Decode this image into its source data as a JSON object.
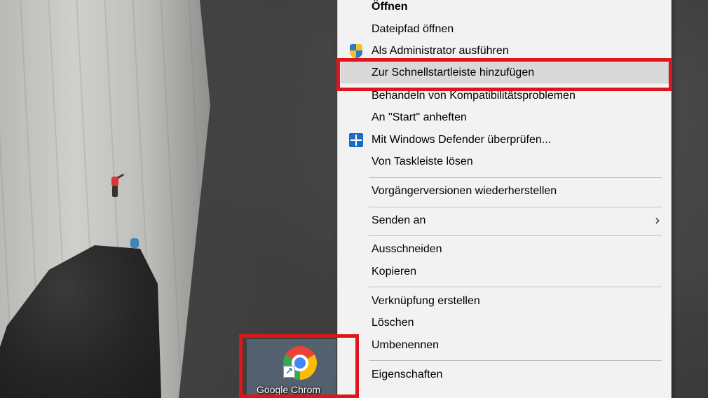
{
  "desktop": {
    "shortcut": {
      "label": "Google Chrom",
      "icon": "chrome-icon",
      "overlay_icon": "shortcut-arrow-icon"
    }
  },
  "context_menu": {
    "items": [
      {
        "label": "Öffnen",
        "bold": true
      },
      {
        "label": "Dateipfad öffnen"
      },
      {
        "label": "Als Administrator ausführen",
        "icon": "uac-shield-icon"
      },
      {
        "label": "Zur Schnellstartleiste hinzufügen",
        "hovered": true
      },
      {
        "label": "Behandeln von Kompatibilitätsproblemen"
      },
      {
        "label": "An \"Start\" anheften"
      },
      {
        "label": "Mit Windows Defender überprüfen...",
        "icon": "windows-defender-icon"
      },
      {
        "label": "Von Taskleiste lösen"
      },
      {
        "label": "Vorgängerversionen wiederherstellen"
      },
      {
        "label": "Senden an",
        "submenu": true,
        "submenu_icon": "chevron-right-icon"
      },
      {
        "label": "Ausschneiden"
      },
      {
        "label": "Kopieren"
      },
      {
        "label": "Verknüpfung erstellen"
      },
      {
        "label": "Löschen"
      },
      {
        "label": "Umbenennen"
      },
      {
        "label": "Eigenschaften"
      }
    ],
    "submenu_glyph": "›"
  },
  "colors": {
    "menu_background": "#f2f2f2",
    "hover_background": "#d9d9d9",
    "highlight_box": "#e0151b"
  }
}
